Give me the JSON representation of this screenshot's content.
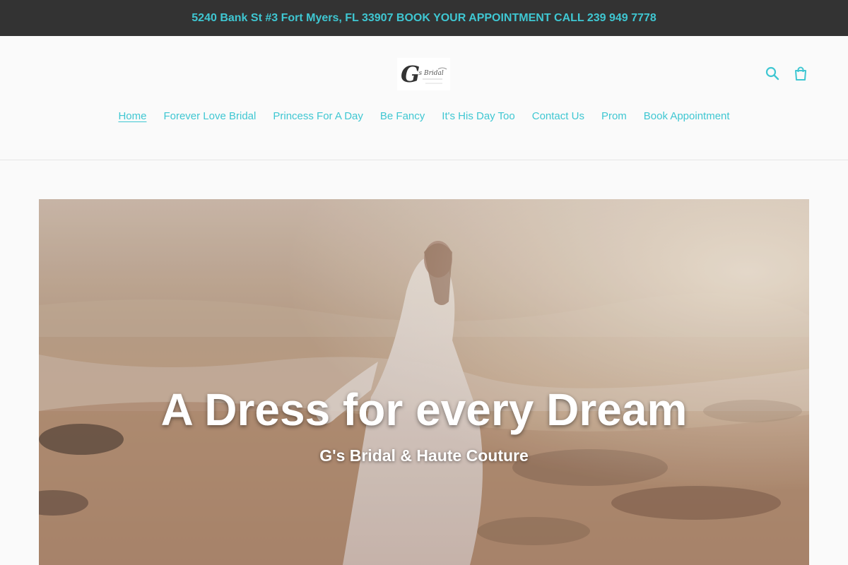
{
  "announcement": {
    "text": "5240 Bank St #3 Fort Myers, FL 33907 BOOK YOUR APPOINTMENT CALL 239 949 7778"
  },
  "header": {
    "logo_alt": "G's Bridal & Haute Couture",
    "icons": [
      "search-icon",
      "cart-icon"
    ]
  },
  "nav": {
    "items": [
      {
        "label": "Home",
        "active": true
      },
      {
        "label": "Forever Love Bridal"
      },
      {
        "label": "Princess For A Day"
      },
      {
        "label": "Be Fancy"
      },
      {
        "label": "It's His Day Too"
      },
      {
        "label": "Contact Us"
      },
      {
        "label": "Prom"
      },
      {
        "label": "Book Appointment"
      }
    ]
  },
  "hero": {
    "title": "A Dress for every Dream",
    "subtitle": "G's Bridal & Haute Couture"
  },
  "colors": {
    "accent": "#3fc7d2",
    "announcement_bg": "#333333",
    "page_bg": "#fafafa"
  }
}
